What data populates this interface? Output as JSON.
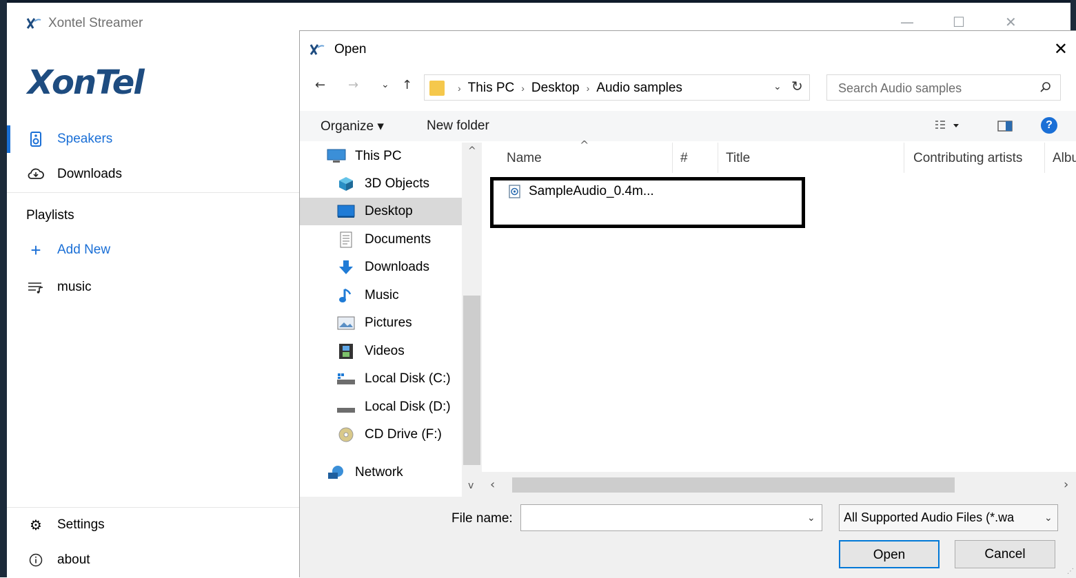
{
  "app": {
    "title": "Xontel Streamer",
    "brand": "XonTel",
    "window_controls": {
      "minimize": "—",
      "maximize": "☐",
      "close": "✕"
    },
    "nav": [
      {
        "label": "Speakers",
        "icon": "speaker-icon",
        "active": true
      },
      {
        "label": "Downloads",
        "icon": "cloud-download-icon",
        "active": false
      }
    ],
    "playlists_heading": "Playlists",
    "add_new": "Add New",
    "playlists": [
      {
        "label": "music",
        "icon": "playlist-icon"
      }
    ],
    "settings": "Settings",
    "about": "about",
    "accent_color": "#1a6fd6"
  },
  "dialog": {
    "title": "Open",
    "close": "✕",
    "nav": {
      "back": "←",
      "forward": "→",
      "recent": "⌄",
      "up": "↑"
    },
    "breadcrumbs": [
      "This PC",
      "Desktop",
      "Audio samples"
    ],
    "search_placeholder": "Search Audio samples",
    "toolbar": {
      "organize": "Organize ▾",
      "new_folder": "New folder",
      "help": "?"
    },
    "tree": [
      {
        "label": "This PC",
        "icon": "computer-icon",
        "level": 0
      },
      {
        "label": "3D Objects",
        "icon": "cube-icon",
        "level": 1
      },
      {
        "label": "Desktop",
        "icon": "desktop-icon",
        "level": 1,
        "selected": true
      },
      {
        "label": "Documents",
        "icon": "document-icon",
        "level": 1
      },
      {
        "label": "Downloads",
        "icon": "download-arrow-icon",
        "level": 1
      },
      {
        "label": "Music",
        "icon": "music-note-icon",
        "level": 1
      },
      {
        "label": "Pictures",
        "icon": "pictures-icon",
        "level": 1
      },
      {
        "label": "Videos",
        "icon": "film-icon",
        "level": 1
      },
      {
        "label": "Local Disk (C:)",
        "icon": "drive-c-icon",
        "level": 1
      },
      {
        "label": "Local Disk (D:)",
        "icon": "drive-icon",
        "level": 1
      },
      {
        "label": "CD Drive (F:)",
        "icon": "cd-icon",
        "level": 1
      },
      {
        "label": "Network",
        "icon": "network-icon",
        "level": 0
      }
    ],
    "columns": [
      "Name",
      "#",
      "Title",
      "Contributing artists",
      "Albu"
    ],
    "files": [
      {
        "name": "SampleAudio_0.4m...",
        "icon": "audio-file-icon"
      }
    ],
    "file_name_label": "File name:",
    "file_name_value": "",
    "filter": "All Supported Audio Files (*.wa",
    "open_button": "Open",
    "cancel_button": "Cancel"
  }
}
